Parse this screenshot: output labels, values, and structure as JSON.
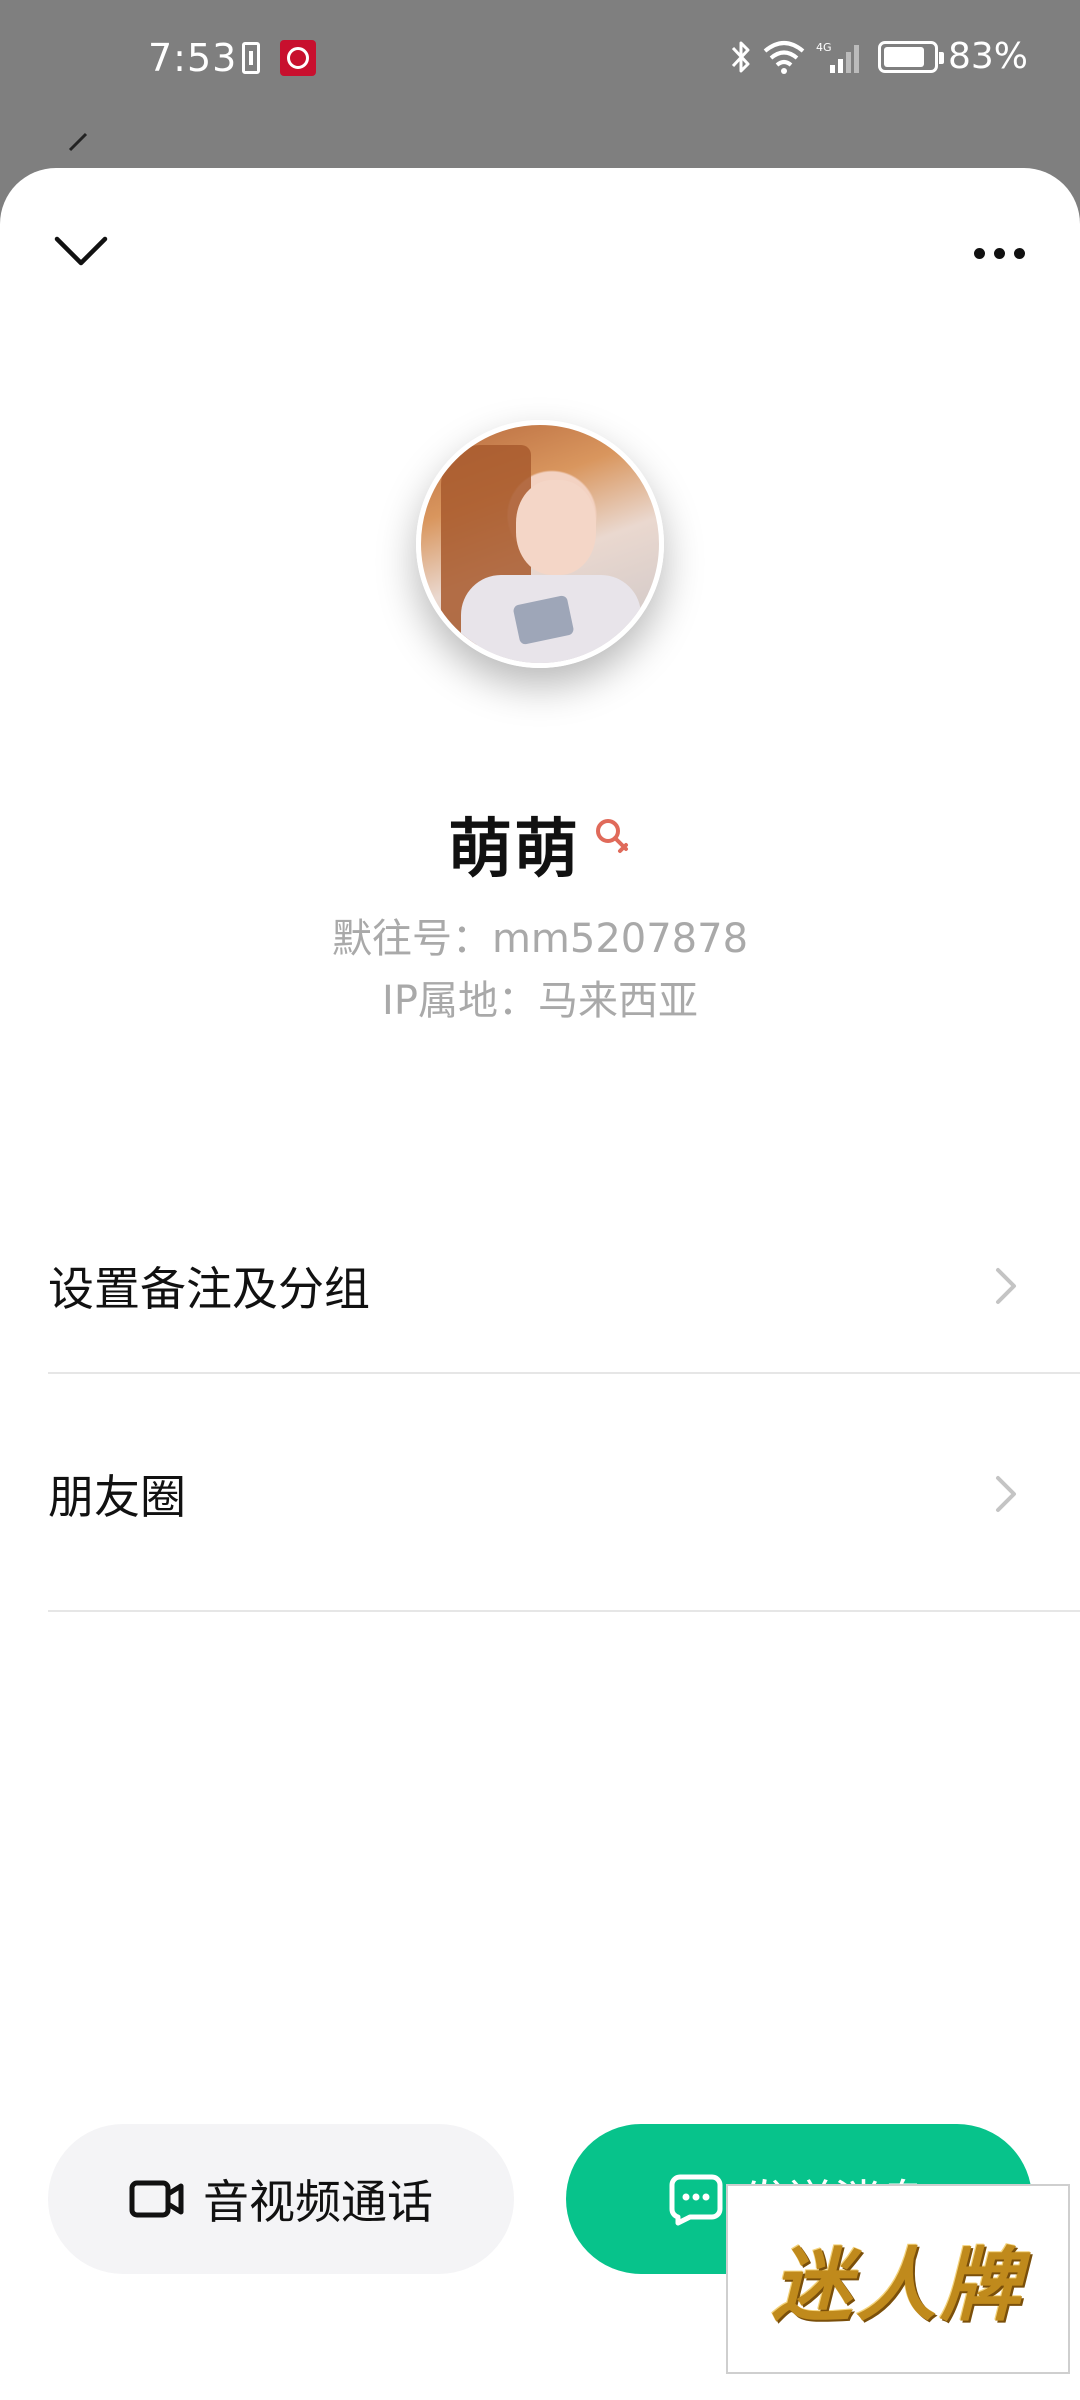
{
  "status_bar": {
    "time": "7:53",
    "network": "4G",
    "battery": "83%"
  },
  "profile": {
    "name": "萌萌",
    "account_line": "默往号：mm5207878",
    "ip_line": "IP属地：马来西亚",
    "gender_icon": "female-icon",
    "gender_color": "#e06a5a"
  },
  "menu": {
    "items": [
      {
        "label": "设置备注及分组"
      },
      {
        "label": "朋友圈"
      }
    ]
  },
  "actions": {
    "call_label": "音视频通话",
    "message_label": "发送消息",
    "accent_color": "#07c38b"
  },
  "watermark": {
    "text": "迷人牌"
  }
}
